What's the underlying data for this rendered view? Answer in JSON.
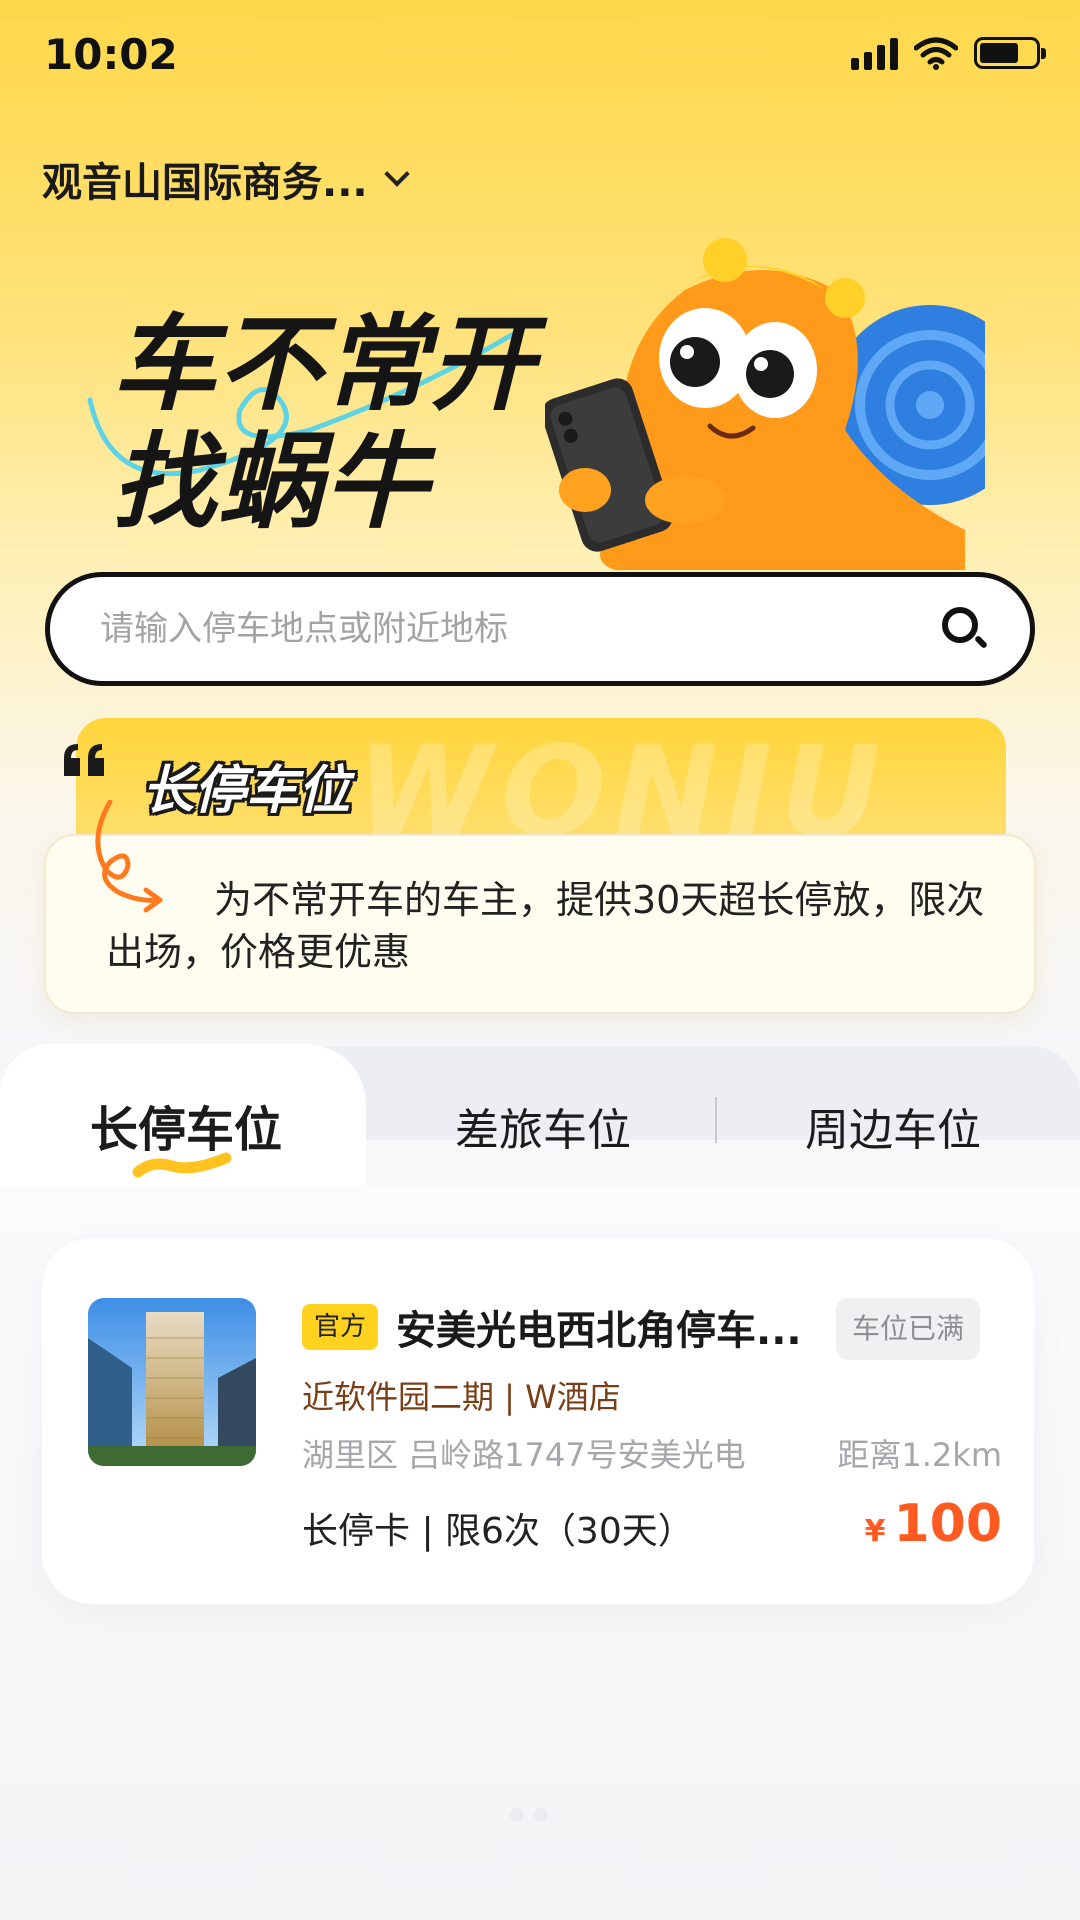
{
  "status_bar": {
    "time": "10:02"
  },
  "location": {
    "label": "观音山国际商务..."
  },
  "hero": {
    "line1": "车不常开",
    "line2": "找蜗牛"
  },
  "search": {
    "placeholder": "请输入停车地点或附近地标"
  },
  "promo": {
    "watermark": "WONIU",
    "title": "长停车位",
    "description": "为不常开车的车主，提供30天超长停放，限次出场，价格更优惠"
  },
  "tabs": [
    {
      "label": "长停车位",
      "active": true
    },
    {
      "label": "差旅车位",
      "active": false
    },
    {
      "label": "周边车位",
      "active": false
    }
  ],
  "parking_card": {
    "badge": "官方",
    "title": "安美光电西北角停车...",
    "status": "车位已满",
    "landmark": "近软件园二期 | W酒店",
    "address": "湖里区 吕岭路1747号安美光电",
    "distance": "距离1.2km",
    "plan": "长停卡 | 限6次（30天）",
    "price_symbol": "¥",
    "price": "100"
  },
  "colors": {
    "brand_yellow": "#ffd21f",
    "price_orange": "#ff5a1f",
    "landmark_brown": "#7a3e16"
  },
  "icons": [
    "signal-icon",
    "wifi-icon",
    "battery-icon",
    "chevron-down-icon",
    "search-icon",
    "quote-icon"
  ]
}
